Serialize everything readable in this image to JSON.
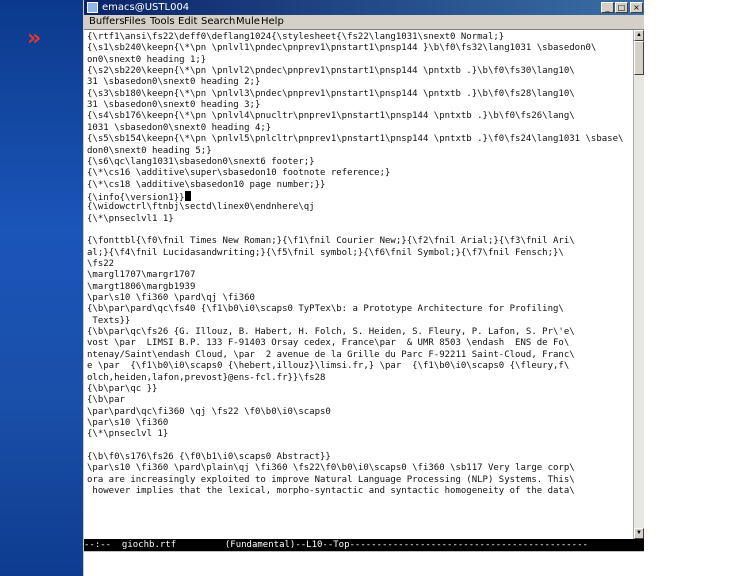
{
  "window": {
    "title": "emacs@USTL004",
    "min_glyph": "_",
    "max_glyph": "□",
    "close_glyph": "×"
  },
  "slide": {
    "chevron": "»"
  },
  "menu": [
    "Buffers",
    "Files",
    "Tools",
    "Edit",
    "Search",
    "Mule",
    "Help"
  ],
  "editor": {
    "lines": [
      "{\\rtf1\\ansi\\fs22\\deff0\\deflang1024{\\stylesheet{\\fs22\\lang1031\\snext0 Normal;}",
      "{\\s1\\sb240\\keepn{\\*\\pn \\pnlvl1\\pndec\\pnprev1\\pnstart1\\pnsp144 }\\b\\f0\\fs32\\lang1031 \\sbasedon0\\",
      "on0\\snext0 heading 1;}",
      "{\\s2\\sb220\\keepn{\\*\\pn \\pnlvl2\\pndec\\pnprev1\\pnstart1\\pnsp144 \\pntxtb .}\\b\\f0\\fs30\\lang10\\",
      "31 \\sbasedon0\\snext0 heading 2;}",
      "{\\s3\\sb180\\keepn{\\*\\pn \\pnlvl3\\pndec\\pnprev1\\pnstart1\\pnsp144 \\pntxtb .}\\b\\f0\\fs28\\lang10\\",
      "31 \\sbasedon0\\snext0 heading 3;}",
      "{\\s4\\sb176\\keepn{\\*\\pn \\pnlvl4\\pnucltr\\pnprev1\\pnstart1\\pnsp144 \\pntxtb .}\\b\\f0\\fs26\\lang\\",
      "1031 \\sbasedon0\\snext0 heading 4;}",
      "{\\s5\\sb154\\keepn{\\*\\pn \\pnlvl5\\pnlcltr\\pnprev1\\pnstart1\\pnsp144 \\pntxtb .}\\f0\\fs24\\lang1031 \\sbase\\",
      "don0\\snext0 heading 5;}",
      "{\\s6\\qc\\lang1031\\sbasedon0\\snext6 footer;}",
      "{\\*\\cs16 \\additive\\super\\sbasedon10 footnote reference;}",
      "{\\*\\cs18 \\additive\\sbasedon10 page number;}}",
      "{\\info{\\version1}}",
      "{\\widowctrl\\ftnbj\\sectd\\linex0\\endnhere\\qj",
      "{\\*\\pnseclvl1 1}",
      "",
      "{\\fonttbl{\\f0\\fnil Times New Roman;}{\\f1\\fnil Courier New;}{\\f2\\fnil Arial;}{\\f3\\fnil Ari\\",
      "al;}{\\f4\\fnil Lucidasandwriting;}{\\f5\\fnil symbol;}{\\f6\\fnil Symbol;}{\\f7\\fnil Fensch;}\\",
      "\\fs22",
      "\\margl1707\\margr1707",
      "\\margt1806\\margb1939",
      "\\par\\s10 \\fi360 \\pard\\qj \\fi360",
      "{\\b\\par\\pard\\qc\\fs40 {\\f1\\b0\\i0\\scaps0 TyPTex\\b: a Prototype Architecture for Profiling\\",
      " Texts}}",
      "{\\b\\par\\qc\\fs26 {G. Illouz, B. Habert, H. Folch, S. Heiden, S. Fleury, P. Lafon, S. Pr\\'e\\",
      "vost \\par  LIMSI B.P. 133 F-91403 Orsay cedex, France\\par  & UMR 8503 \\endash  ENS de Fo\\",
      "ntenay/Saint\\endash Cloud, \\par  2 avenue de la Grille du Parc F-92211 Saint-Cloud, Franc\\",
      "e \\par  {\\f1\\b0\\i0\\scaps0 {\\hebert,illouz}\\limsi.fr,} \\par  {\\f1\\b0\\i0\\scaps0 {\\fleury,f\\",
      "olch,heiden,lafon,prevost}@ens-fcl.fr}}\\fs28",
      "{\\b\\par\\qc }}",
      "{\\b\\par",
      "\\par\\pard\\qc\\fi360 \\qj \\fs22 \\f0\\b0\\i0\\scaps0",
      "\\par\\s10 \\fi360",
      "{\\*\\pnseclvl 1}",
      "",
      "{\\b\\f0\\s176\\fs26 {\\f0\\b1\\i0\\scaps0 Abstract}}",
      "\\par\\s10 \\fi360 \\pard\\plain\\qj \\fi360 \\fs22\\f0\\b0\\i0\\scaps0 \\fi360 \\sb117 Very large corp\\",
      "ora are increasingly exploited to improve Natural Language Processing (NLP) Systems. This\\",
      " however implies that the lexical, morpho-syntactic and syntactic homogeneity of the data\\"
    ],
    "cursor_line": 14
  },
  "modeline": "--:--  giochb.rtf         (Fundamental)--L10--Top--------------------------------------------"
}
